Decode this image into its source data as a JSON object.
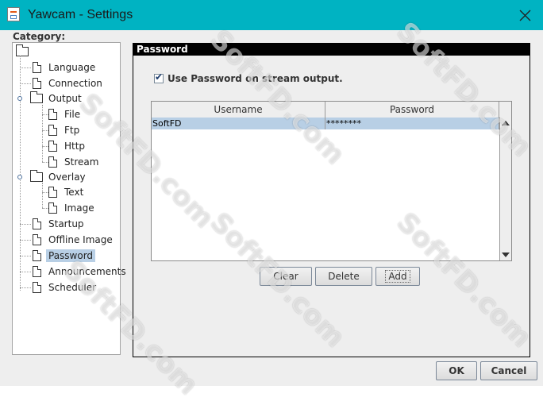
{
  "window": {
    "title": "Yawcam - Settings",
    "title_bar_color": "#00b3c2"
  },
  "category": {
    "label": "Category:",
    "items": [
      {
        "label": "Language"
      },
      {
        "label": "Connection"
      },
      {
        "label": "Output",
        "children": [
          {
            "label": "File"
          },
          {
            "label": "Ftp"
          },
          {
            "label": "Http"
          },
          {
            "label": "Stream"
          }
        ]
      },
      {
        "label": "Overlay",
        "children": [
          {
            "label": "Text"
          },
          {
            "label": "Image"
          }
        ]
      },
      {
        "label": "Startup"
      },
      {
        "label": "Offline Image"
      },
      {
        "label": "Password",
        "selected": true
      },
      {
        "label": "Announcements"
      },
      {
        "label": "Scheduler"
      }
    ],
    "selection_color": "#b8cfe5"
  },
  "panel": {
    "header": "Password",
    "use_password": {
      "label": "Use Password on stream output.",
      "checked": true
    },
    "table": {
      "columns": [
        "Username",
        "Password"
      ],
      "rows": [
        {
          "username": "SoftFD",
          "password": "********"
        }
      ]
    },
    "buttons": {
      "clear": "Clear",
      "delete": "Delete",
      "add": "Add"
    }
  },
  "footer": {
    "ok": "OK",
    "cancel": "Cancel"
  },
  "watermark": "SoftFD.com"
}
